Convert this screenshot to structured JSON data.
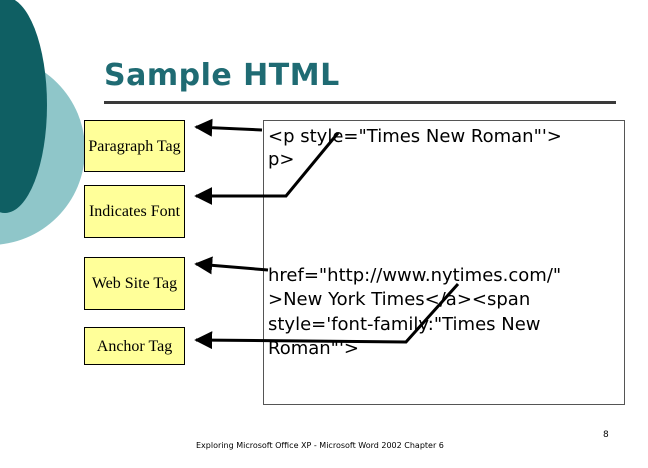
{
  "slide": {
    "title": "Sample HTML",
    "labels": {
      "paragraph": "Paragraph Tag",
      "font": "Indicates Font",
      "website": "Web Site Tag",
      "anchor": "Anchor Tag"
    },
    "code": {
      "line1": "<p style=\"Times New Roman\"'>",
      "line2": "p>",
      "line3": "href=\"http://www.nytimes.com/\"",
      "line4": ">New York Times</a><span",
      "line5": "style='font-family:\"Times New",
      "line6": "Roman\"'>"
    },
    "footer": "Exploring Microsoft Office XP - Microsoft Word 2002 Chapter 6",
    "page_number": "8"
  },
  "colors": {
    "title": "#1f6b73",
    "label_fill": "#ffff99",
    "deco_dark": "#0f5f63",
    "deco_light": "#8fc6c9"
  }
}
